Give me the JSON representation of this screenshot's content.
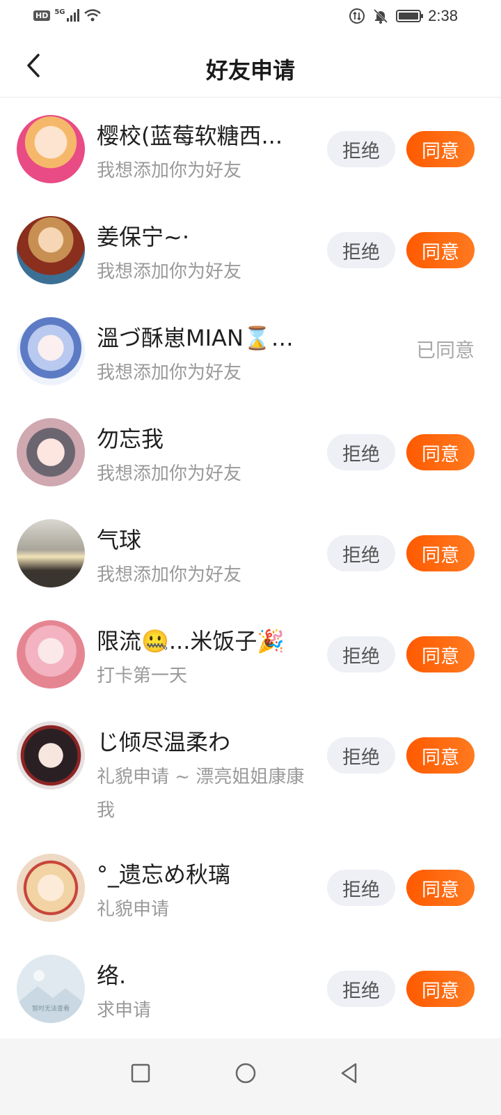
{
  "status_bar": {
    "hd": "HD",
    "network": "5G",
    "time": "2:38"
  },
  "header": {
    "title": "好友申请"
  },
  "buttons": {
    "reject": "拒绝",
    "accept": "同意"
  },
  "requests": [
    {
      "name": "樱校(蓝莓软糖西...",
      "message": "我想添加你为好友",
      "status": "pending",
      "avatar_color": "#f7b6c8"
    },
    {
      "name": "姜保宁~·",
      "message": "我想添加你为好友",
      "status": "pending",
      "avatar_color": "#7a9fb8"
    },
    {
      "name": "溫づ酥崽MIAN⌛🌷📢",
      "message": "我想添加你为好友",
      "status": "accepted",
      "status_label": "已同意",
      "avatar_color": "#c9d6f2"
    },
    {
      "name": "勿忘我",
      "message": "我想添加你为好友",
      "status": "pending",
      "avatar_color": "#d7c1c7"
    },
    {
      "name": "气球",
      "message": "我想添加你为好友",
      "status": "pending",
      "avatar_color": "#8e8d88"
    },
    {
      "name": "限流🤐...米饭子🎉",
      "message": "打卡第一天",
      "status": "pending",
      "avatar_color": "#f2c6cc"
    },
    {
      "name": "じ倾尽温柔わ",
      "message": "礼貌申请 ~ 漂亮姐姐康康我",
      "status": "pending",
      "avatar_color": "#4b3b3a"
    },
    {
      "name": "°_遗忘め秋璃",
      "message": "礼貌申请",
      "status": "pending",
      "avatar_color": "#f2d7b8"
    },
    {
      "name": "络.",
      "message": "求申请",
      "status": "pending",
      "avatar_color": "#dfe9ef",
      "avatar_text": "暂时无法查看"
    }
  ]
}
